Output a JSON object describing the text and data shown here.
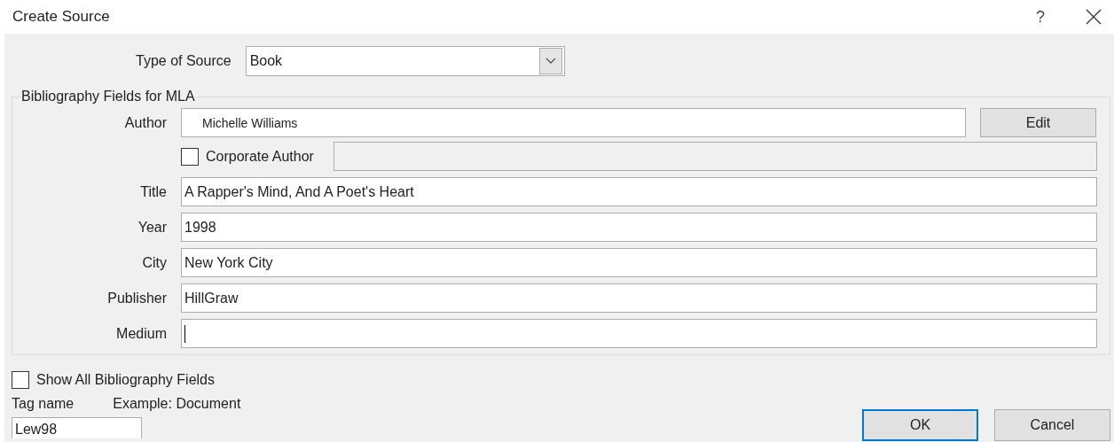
{
  "window": {
    "title": "Create Source",
    "help": "?"
  },
  "type_of_source": {
    "label": "Type of Source",
    "value": "Book"
  },
  "group": {
    "title": "Bibliography Fields for MLA",
    "author": {
      "label": "Author",
      "value": "Michelle Williams",
      "button": "Edit"
    },
    "corporate_author": {
      "label": "Corporate Author",
      "checked": false,
      "disabled": true
    },
    "fields": [
      {
        "label": "Title",
        "value": "A Rapper's Mind, And A Poet's Heart",
        "focused": false
      },
      {
        "label": "Year",
        "value": "1998",
        "focused": false
      },
      {
        "label": "City",
        "value": "New York City",
        "focused": false
      },
      {
        "label": "Publisher",
        "value": "HillGraw",
        "focused": false
      },
      {
        "label": "Medium",
        "focused": true
      }
    ]
  },
  "show_all": {
    "label": "Show All Bibliography Fields",
    "checked": false
  },
  "tag": {
    "label": "Tag name",
    "value": "Lew98",
    "example": "Example: Document"
  },
  "buttons": [
    {
      "label": "OK",
      "default": true
    },
    {
      "label": "Cancel",
      "default": false
    }
  ]
}
